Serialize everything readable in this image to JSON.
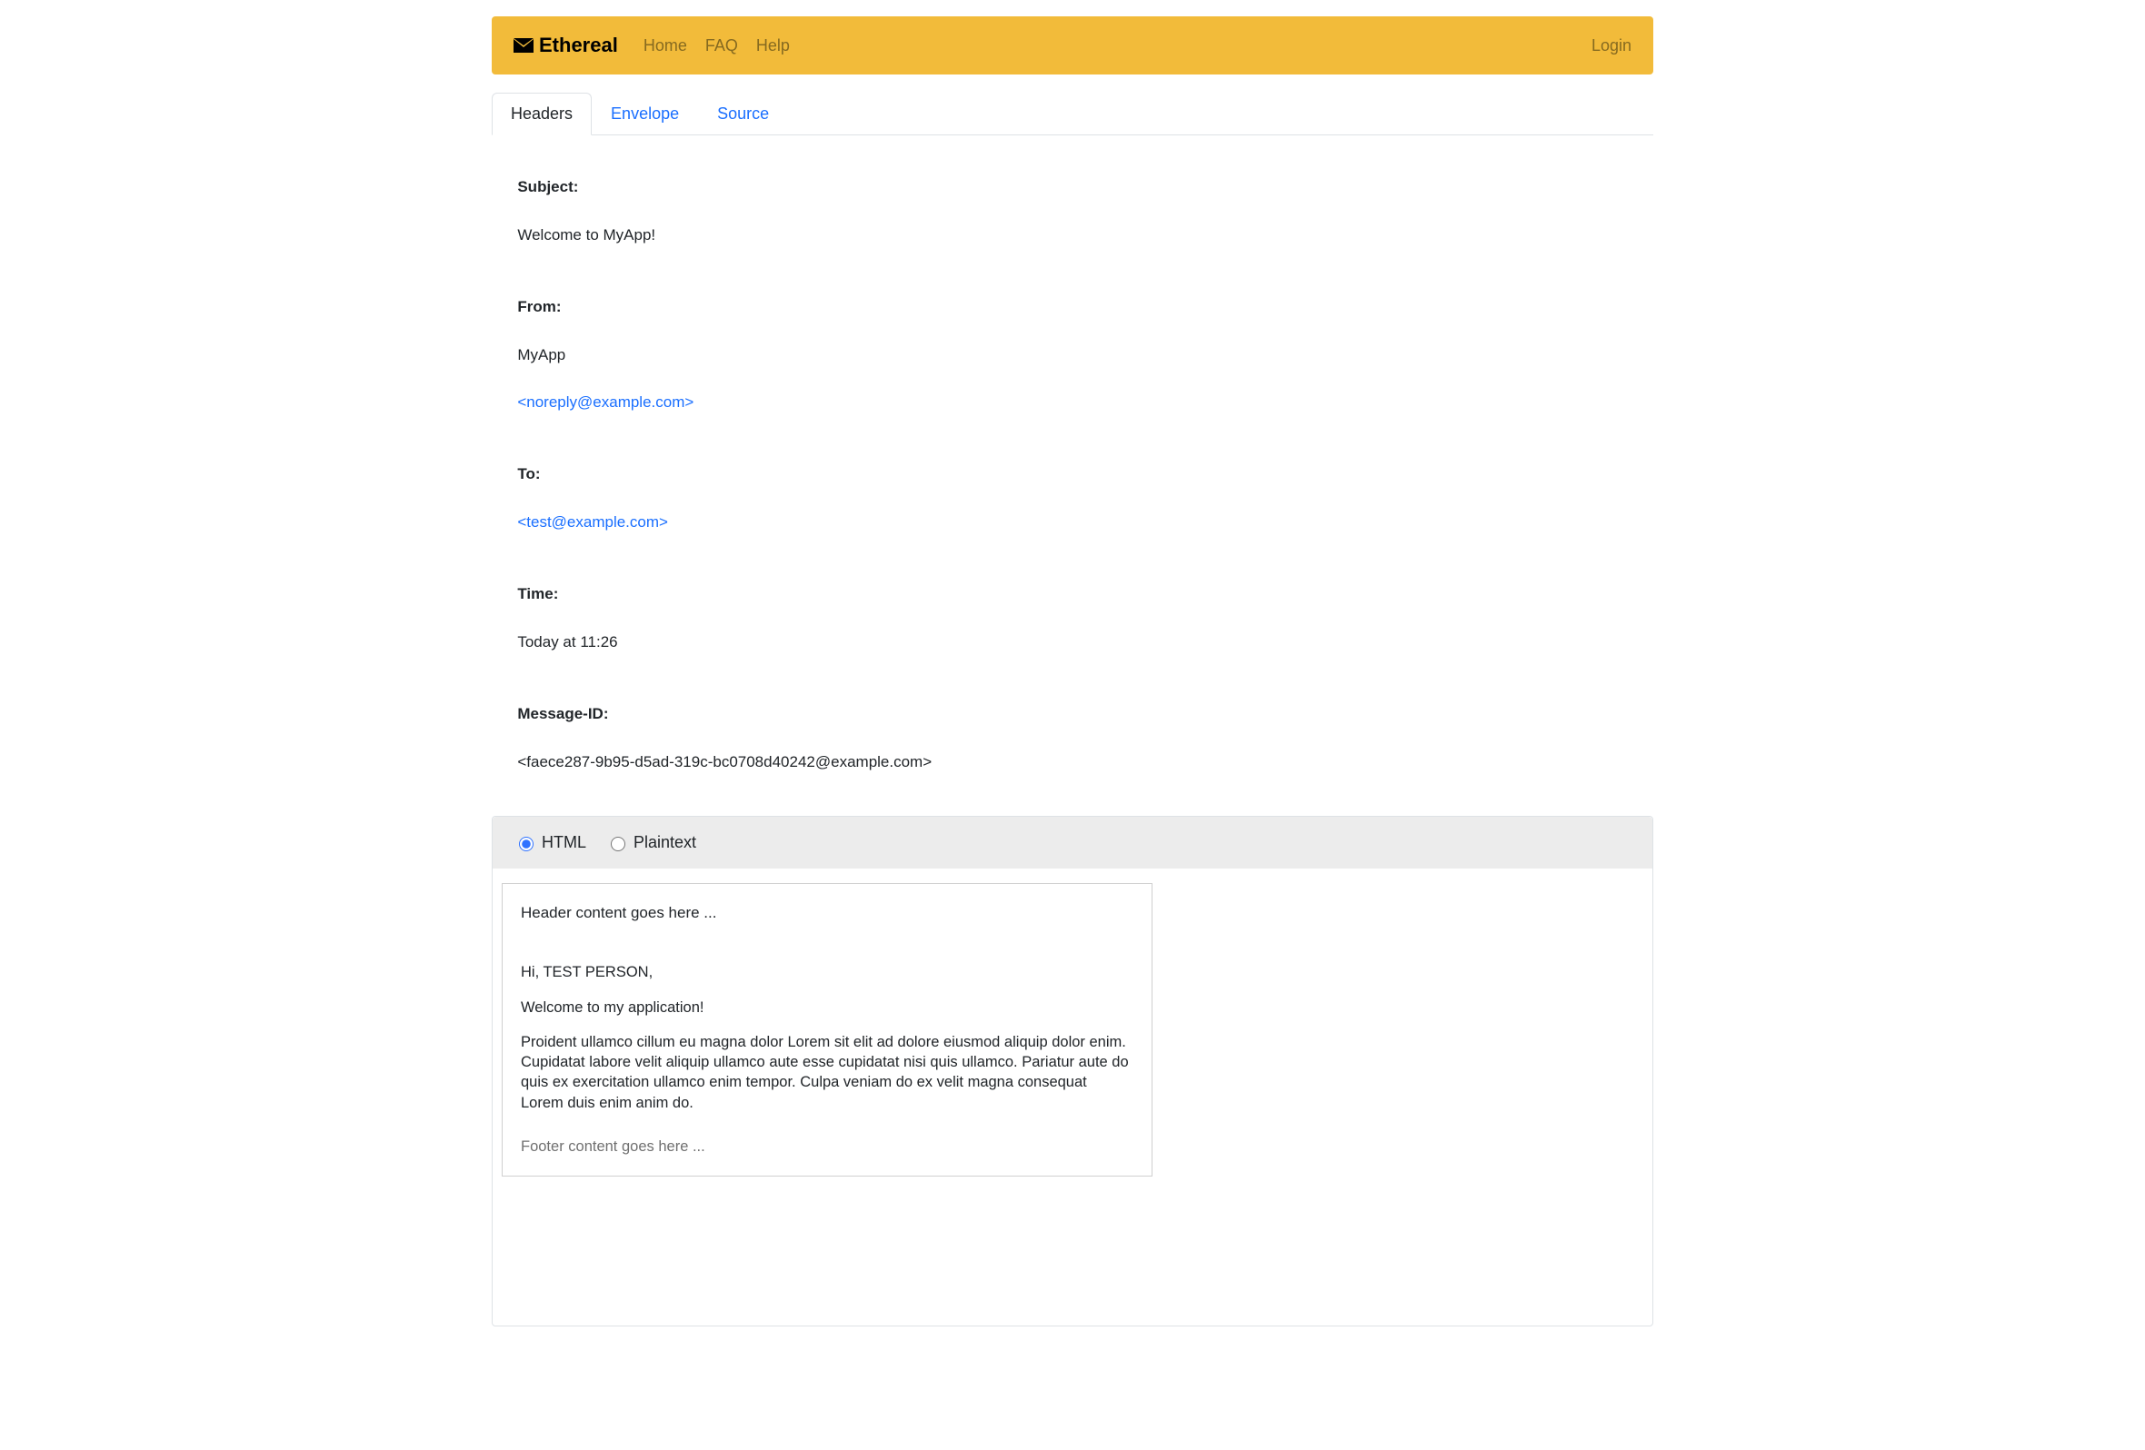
{
  "brand": "Ethereal",
  "nav": {
    "home": "Home",
    "faq": "FAQ",
    "help": "Help",
    "login": "Login"
  },
  "tabs": {
    "headers": "Headers",
    "envelope": "Envelope",
    "source": "Source"
  },
  "headers": {
    "subject_label": "Subject:",
    "subject": "Welcome to MyApp!",
    "from_label": "From:",
    "from_name": "MyApp",
    "from_addr": "<noreply@example.com>",
    "to_label": "To:",
    "to_addr": "<test@example.com>",
    "time_label": "Time:",
    "time": "Today at 11:26",
    "msgid_label": "Message-ID:",
    "msgid": "<faece287-9b95-d5ad-319c-bc0708d40242@example.com>"
  },
  "view_toggle": {
    "html": "HTML",
    "plaintext": "Plaintext"
  },
  "message": {
    "header": "Header content goes here ...",
    "greeting": "Hi, TEST PERSON,",
    "welcome": "Welcome to my application!",
    "body": "Proident ullamco cillum eu magna dolor Lorem sit elit ad dolore eiusmod aliquip dolor enim. Cupidatat labore velit aliquip ullamco aute esse cupidatat nisi quis ullamco. Pariatur aute do quis ex exercitation ullamco enim tempor. Culpa veniam do ex velit magna consequat Lorem duis enim anim do.",
    "footer": "Footer content goes here ..."
  }
}
